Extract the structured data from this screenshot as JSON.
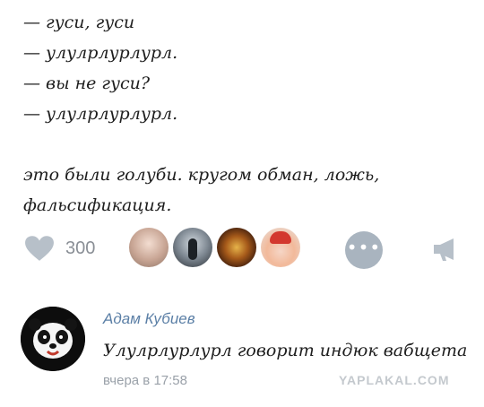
{
  "post": {
    "lines": [
      "— гуси, гуси",
      "— улулрлурлурл.",
      "— вы не гуси?",
      "— улулрлурлурл.",
      "это были голуби. кругом обман, ложь,",
      "фальсификация."
    ]
  },
  "actions": {
    "like_count": "300",
    "icons": {
      "like": "heart-icon",
      "share": "more-icon",
      "promote": "megaphone-icon"
    },
    "colors": {
      "icon_gray": "#b7c0c9",
      "share_bg": "#a9b4bf",
      "count": "#8a8f96"
    }
  },
  "comment": {
    "author": "Адам Кубиев",
    "text": "Улулрлурлурл говорит индюк вабщета",
    "time": "вчера в 17:58",
    "author_color": "#5b7fa6"
  },
  "watermark": "YAPLAKAL.COM"
}
